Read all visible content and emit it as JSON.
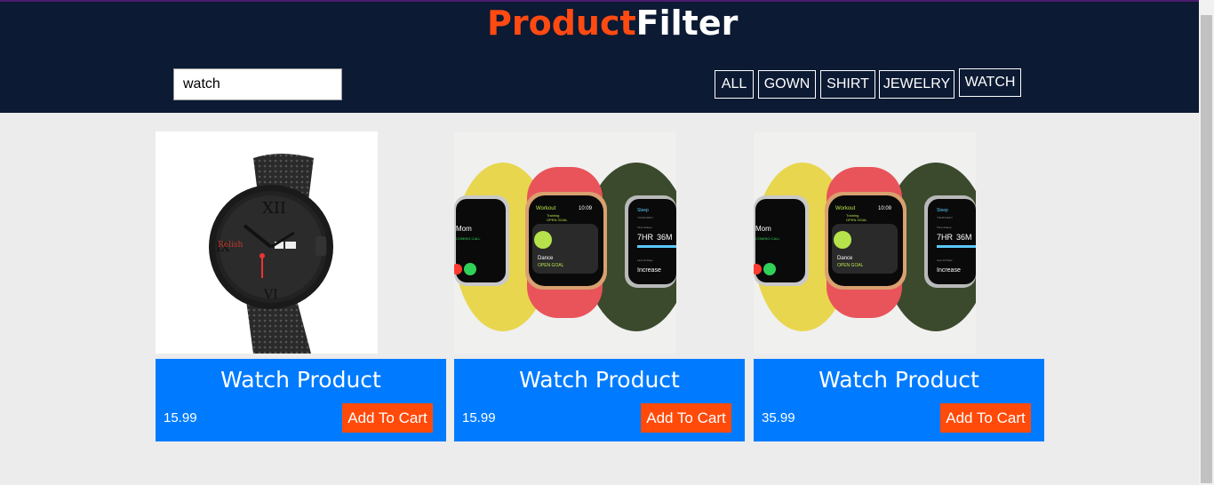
{
  "header": {
    "logo_part1": "Product",
    "logo_part2": "Filter",
    "logo_color1": "#ff4a12",
    "logo_color2": "#ffffff",
    "background": "#0c1a33"
  },
  "search": {
    "value": "watch"
  },
  "filters": [
    {
      "label": "ALL"
    },
    {
      "label": "GOWN"
    },
    {
      "label": "SHIRT"
    },
    {
      "label": "JEWELRY"
    },
    {
      "label": "WATCH"
    }
  ],
  "products": [
    {
      "title": "Watch Product",
      "price": "15.99",
      "cart_label": "Add To Cart",
      "image": "black-mesh-watch"
    },
    {
      "title": "Watch Product",
      "price": "15.99",
      "cart_label": "Add To Cart",
      "image": "apple-watch-trio"
    },
    {
      "title": "Watch Product",
      "price": "35.99",
      "cart_label": "Add To Cart",
      "image": "apple-watch-trio"
    }
  ],
  "watch_screen": {
    "app_left": "Workout",
    "time": "10:09",
    "sub1": "Training",
    "sub2": "OPEN GOAL",
    "activity": "Dance",
    "activity_goal": "OPEN GOAL",
    "right_app": "Sleep",
    "right_sub": "YOUR DAILY",
    "right_label": "Time Asleep",
    "sleep_hr": "7HR",
    "sleep_min": "36M",
    "right_footer": "Last 14 Days",
    "right_value": "Increase",
    "left_name": "Mom",
    "left_sub": "COMING CALL",
    "brand": "Relish"
  },
  "colors": {
    "accent_blue": "#007bff",
    "cart_orange": "#ff4a0a"
  }
}
